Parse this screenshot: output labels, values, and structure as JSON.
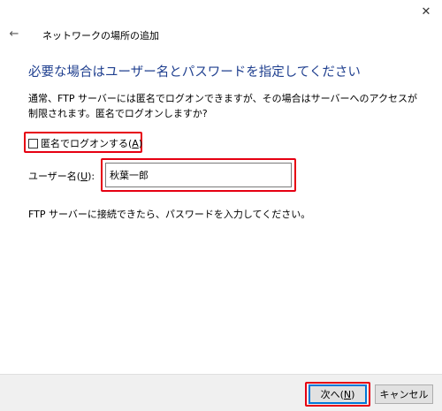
{
  "window": {
    "title": "ネットワークの場所の追加",
    "close_glyph": "✕",
    "back_glyph": "←"
  },
  "page": {
    "heading": "必要な場合はユーザー名とパスワードを指定してください",
    "description": "通常、FTP サーバーには匿名でログオンできますが、その場合はサーバーへのアクセスが制限されます。匿名でログオンしますか?",
    "anonymous_checkbox": {
      "label_prefix": "匿名でログオンする(",
      "access_key": "A",
      "label_suffix": ")",
      "checked": false
    },
    "username": {
      "label_prefix": "ユーザー名(",
      "access_key": "U",
      "label_suffix": "):",
      "value": "秋葉一郎"
    },
    "info": "FTP サーバーに接続できたら、パスワードを入力してください。"
  },
  "footer": {
    "next": {
      "label_prefix": "次へ(",
      "access_key": "N",
      "label_suffix": ")"
    },
    "cancel_label": "キャンセル"
  },
  "colors": {
    "heading": "#1f3f8f",
    "highlight": "#e60012",
    "default_button_border": "#0078d7"
  }
}
